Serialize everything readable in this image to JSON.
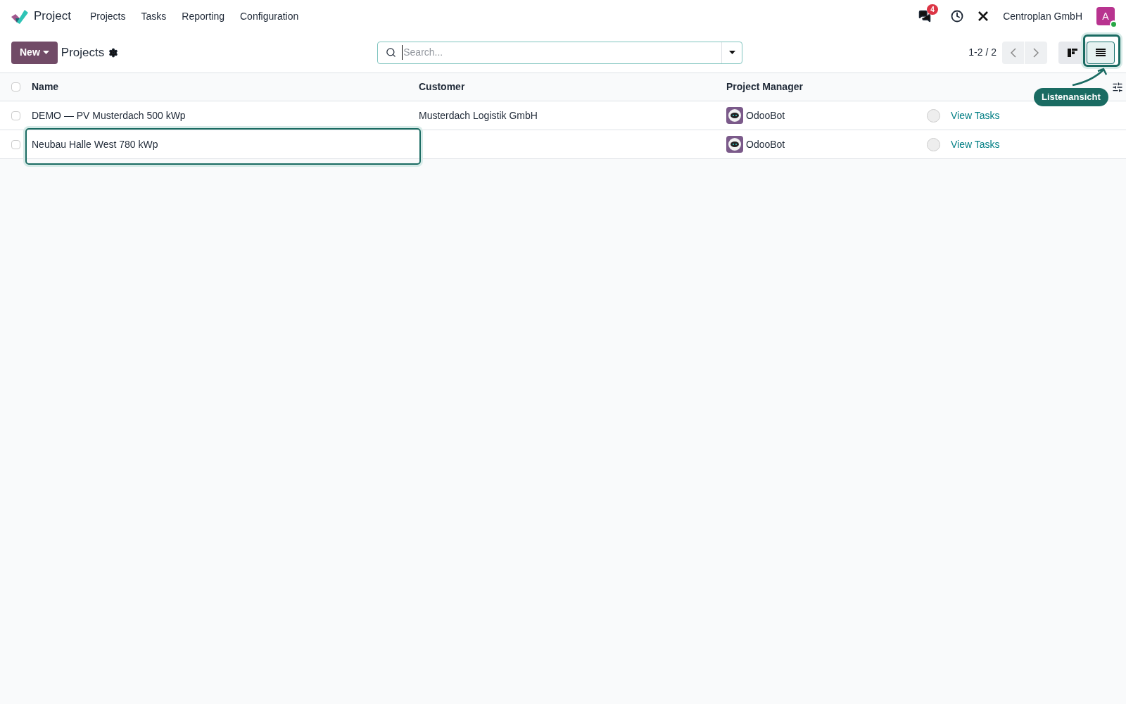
{
  "app": {
    "name": "Project"
  },
  "menu": [
    {
      "label": "Projects"
    },
    {
      "label": "Tasks"
    },
    {
      "label": "Reporting"
    },
    {
      "label": "Configuration"
    }
  ],
  "systray": {
    "messages_badge": "4",
    "company": "Centroplan GmbH",
    "avatar": "A",
    "online": true
  },
  "control_panel": {
    "new_button": "New",
    "title": "Projects",
    "search": {
      "placeholder": "Search..."
    },
    "pager": "1-2 / 2",
    "views": [
      {
        "kind": "kanban",
        "selected": false
      },
      {
        "kind": "list",
        "selected": true
      }
    ]
  },
  "table": {
    "all_checked": false,
    "columns": [
      "Name",
      "Customer",
      "Project Manager"
    ],
    "rows": [
      {
        "checked": false,
        "highlighted": false,
        "name": "DEMO — PV Musterdach 500 kWp",
        "customer": "Musterdach Logistik GmbH",
        "manager": "OdooBot",
        "action": "View Tasks"
      },
      {
        "checked": false,
        "highlighted": true,
        "name": "Neubau Halle West 780 kWp",
        "customer": "",
        "manager": "OdooBot",
        "action": "View Tasks"
      }
    ]
  },
  "annotation": {
    "label": "Listenansicht"
  }
}
